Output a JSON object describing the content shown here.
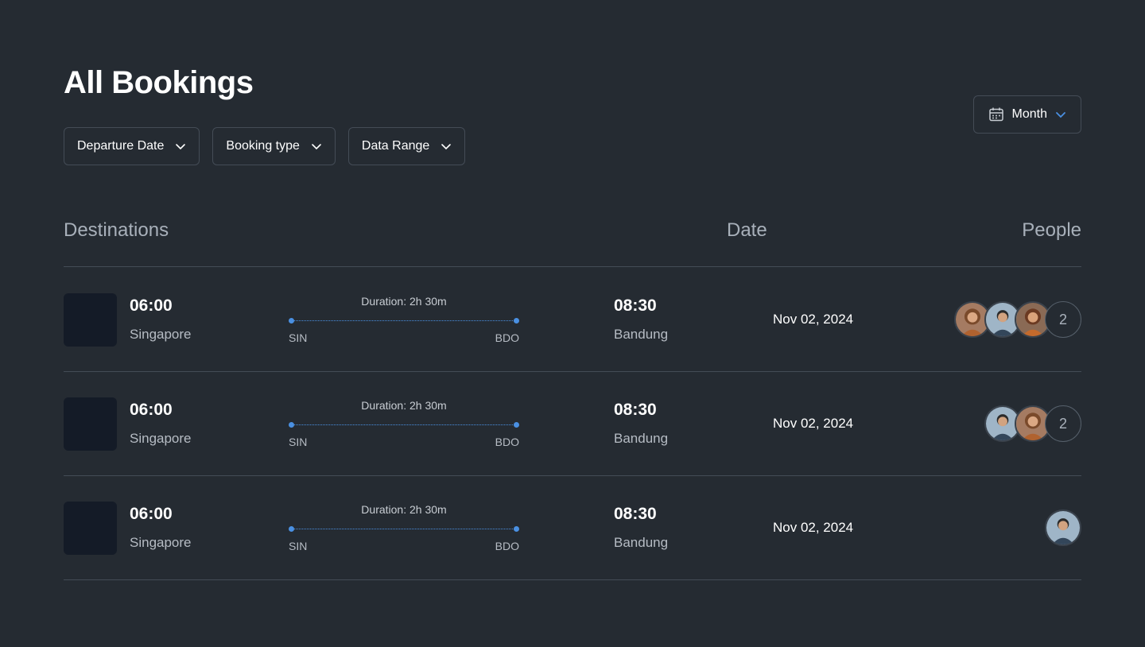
{
  "title": "All Bookings",
  "filters": [
    {
      "label": "Departure Date"
    },
    {
      "label": "Booking type"
    },
    {
      "label": "Data Range"
    }
  ],
  "period": {
    "label": "Month",
    "icon": "calendar-icon"
  },
  "columns": {
    "destinations": "Destinations",
    "date": "Date",
    "people": "People"
  },
  "accent_color": "#4a90e2",
  "bookings": [
    {
      "departure_time": "06:00",
      "departure_city": "Singapore",
      "departure_code": "SIN",
      "arrival_time": "08:30",
      "arrival_city": "Bandung",
      "arrival_code": "BDO",
      "duration": "Duration: 2h 30m",
      "date": "Nov 02, 2024",
      "avatars": [
        "woman-avatar",
        "man-avatar",
        "woman-avatar"
      ],
      "extra_count": "2"
    },
    {
      "departure_time": "06:00",
      "departure_city": "Singapore",
      "departure_code": "SIN",
      "arrival_time": "08:30",
      "arrival_city": "Bandung",
      "arrival_code": "BDO",
      "duration": "Duration: 2h 30m",
      "date": "Nov 02, 2024",
      "avatars": [
        "man-avatar",
        "woman-avatar"
      ],
      "extra_count": "2"
    },
    {
      "departure_time": "06:00",
      "departure_city": "Singapore",
      "departure_code": "SIN",
      "arrival_time": "08:30",
      "arrival_city": "Bandung",
      "arrival_code": "BDO",
      "duration": "Duration: 2h 30m",
      "date": "Nov 02, 2024",
      "avatars": [
        "man-avatar"
      ],
      "extra_count": ""
    }
  ]
}
